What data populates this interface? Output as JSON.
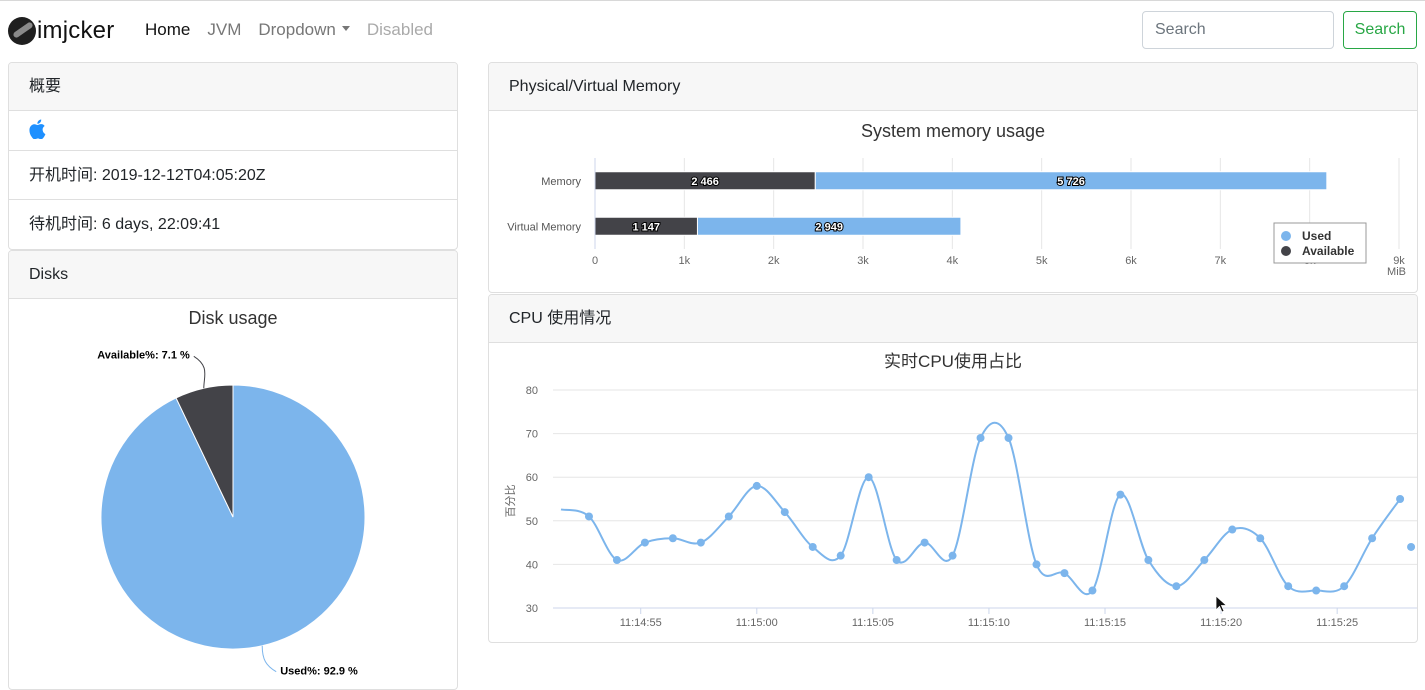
{
  "navbar": {
    "brand": "imjcker",
    "items": [
      {
        "label": "Home",
        "state": "active"
      },
      {
        "label": "JVM",
        "state": "normal"
      },
      {
        "label": "Dropdown",
        "state": "dropdown"
      },
      {
        "label": "Disabled",
        "state": "disabled"
      }
    ],
    "search_placeholder": "Search",
    "search_button": "Search"
  },
  "summary": {
    "header": "概要",
    "os_icon": "apple-icon",
    "boot_time": "开机时间: 2019-12-12T04:05:20Z",
    "uptime": "待机时间: 6 days, 22:09:41"
  },
  "disks": {
    "header": "Disks"
  },
  "memory": {
    "header": "Physical/Virtual Memory"
  },
  "cpu": {
    "header": "CPU 使用情况"
  },
  "colors": {
    "used": "#7cb5ec",
    "available": "#434348",
    "search_green": "#28a745"
  },
  "chart_data": [
    {
      "type": "pie",
      "title": "Disk usage",
      "slices": [
        {
          "label": "Used%: 92.9 %",
          "value": 92.9,
          "color": "#7cb5ec"
        },
        {
          "label": "Available%: 7.1 %",
          "value": 7.1,
          "color": "#434348"
        }
      ]
    },
    {
      "type": "bar",
      "orientation": "horizontal",
      "stacked": true,
      "title": "System memory usage",
      "categories": [
        "Memory",
        "Virtual Memory"
      ],
      "series": [
        {
          "name": "Available",
          "values": [
            2466,
            1147
          ],
          "labels": [
            "2 466",
            "1 147"
          ],
          "color": "#434348"
        },
        {
          "name": "Used",
          "values": [
            5726,
            2949
          ],
          "labels": [
            "5 726",
            "2 949"
          ],
          "color": "#7cb5ec"
        }
      ],
      "xlim": [
        0,
        9000
      ],
      "xticks": [
        "0",
        "1k",
        "2k",
        "3k",
        "4k",
        "5k",
        "6k",
        "7k",
        "8k",
        "9k"
      ],
      "xlabel": "MiB",
      "legend": "bottom-right"
    },
    {
      "type": "line",
      "title": "实时CPU使用占比",
      "ylabel": "百分比",
      "ylim": [
        30,
        80
      ],
      "yticks": [
        30,
        40,
        50,
        60,
        70,
        80
      ],
      "xticks": [
        "11:14:55",
        "11:15:00",
        "11:15:05",
        "11:15:10",
        "11:15:15",
        "11:15:20",
        "11:15:25"
      ],
      "series": [
        {
          "name": "CPU",
          "color": "#7cb5ec",
          "values": [
            52.6,
            51,
            41,
            45,
            46,
            45,
            51,
            58,
            52,
            44,
            42,
            60,
            41,
            45,
            42,
            69,
            69,
            40,
            38,
            34,
            56,
            41,
            35,
            41,
            48,
            46,
            35,
            34,
            35,
            46,
            55,
            44
          ]
        }
      ]
    }
  ]
}
